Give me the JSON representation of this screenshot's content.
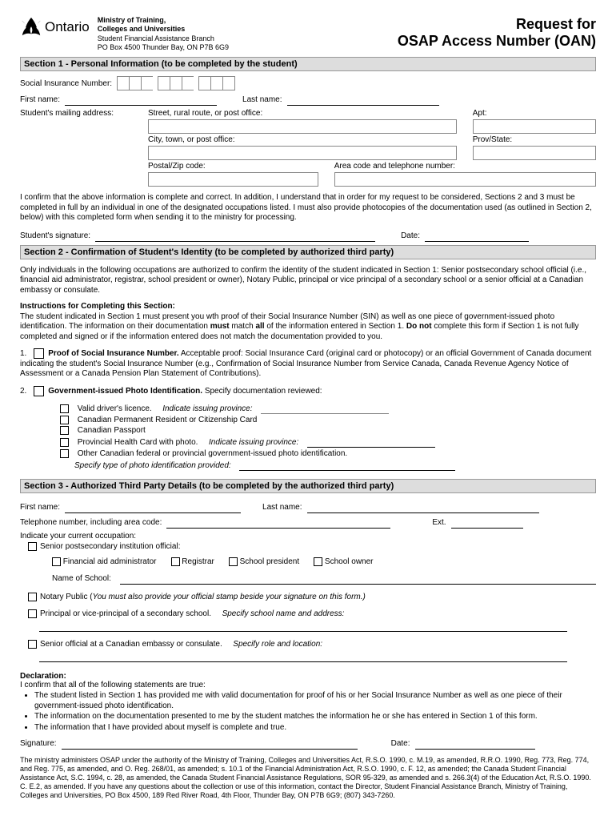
{
  "header": {
    "province": "Ontario",
    "ministry_l1": "Ministry of Training,",
    "ministry_l2": "Colleges and Universities",
    "branch": "Student Financial Assistance Branch",
    "address": "PO Box 4500 Thunder Bay, ON P7B 6G9",
    "title_l1": "Request for",
    "title_l2": "OSAP  Access Number (OAN)"
  },
  "s1": {
    "bar": "Section 1 - Personal Information (to be completed by the student)",
    "sin": "Social Insurance Number:",
    "fname": "First name:",
    "lname": "Last name:",
    "mail": "Student's mailing address:",
    "street": "Street, rural route, or post office:",
    "apt": "Apt:",
    "city": "City, town, or post office:",
    "prov": "Prov/State:",
    "postal": "Postal/Zip code:",
    "phone": "Area code and telephone number:",
    "confirm": "I confirm that the above information is complete and correct.  In addition, I understand that in order for my request to be considered, Sections 2 and 3 must be completed in full by an individual in one of the designated occupations listed.  I must also provide photocopies of the documentation used (as outlined in Section 2, below) with this completed form when sending it to the ministry for processing.",
    "sig": "Student's signature:",
    "date": "Date:"
  },
  "s2": {
    "bar": "Section 2 - Confirmation of Student's Identity (to be completed by authorized third party)",
    "p1": "Only individuals in the following occupations are authorized to confirm the identity of the student indicated in Section 1: Senior postsecondary school official (i.e., financial aid administrator, registrar, school president or owner), Notary Public, principal or vice principal of a secondary school or a senior official at a Canadian embassy or consulate.",
    "instr_h": "Instructions for Completing this Section:",
    "instr": "The student indicated in Section 1 must present you wth proof of their Social Insurance Number (SIN) as well as one piece of government-issued photo identification.  The information on their documentation must match all of the information entered in Section 1.  Do not complete this form if Section 1 is not fully completed and signed or if the information entered does not match the documentation provided to you.",
    "n1": "1.",
    "proof_sin_h": "Proof of Social Insurance Number.",
    "proof_sin": "Acceptable proof:  Social Insurance Card (original card or photocopy) or an official Government of Canada document indicating the student's Social Insurance Number (e.g., Confirmation of Social Insurance Number from Service Canada, Canada Revenue Agency Notice of Assessment or a Canada Pension Plan Statement of Contributions).",
    "n2": "2.",
    "gov_id_h": "Government-issued Photo Identification.",
    "gov_id": "Specify documentation reviewed:",
    "id_dl": "Valid driver's licence.",
    "id_dl_i": "Indicate issuing province:",
    "id_pr": "Canadian Permanent Resident or Citizenship Card",
    "id_pass": "Canadian Passport",
    "id_health": "Provincial Health Card with photo.",
    "id_health_i": "Indicate issuing province:",
    "id_other": "Other Canadian federal or provincial government-issued photo identification.",
    "id_other_i": "Specify type of photo identification provided:"
  },
  "s3": {
    "bar": "Section 3 - Authorized Third Party Details (to be completed by the authorized third party)",
    "fname": "First name:",
    "lname": "Last name:",
    "phone": "Telephone number, including area code:",
    "ext": "Ext.",
    "occ": "Indicate your current occupation:",
    "o_senior": "Senior postsecondary institution official:",
    "o_fin": "Financial aid administrator",
    "o_reg": "Registrar",
    "o_pres": "School president",
    "o_owner": "School owner",
    "school": "Name of School:",
    "o_notary": "Notary Public (",
    "o_notary_i": "You must also provide your official stamp beside your signature on this form.)",
    "o_principal": "Principal or vice-principal of a secondary school.",
    "o_principal_i": "Specify school name and address:",
    "o_embassy": "Senior official at a Canadian embassy or consulate.",
    "o_embassy_i": "Specify role and location:"
  },
  "decl": {
    "h": "Declaration:",
    "intro": "I confirm that all of the following statements are true:",
    "b1": "The student listed in Section 1 has provided me with valid documentation for proof of his or her Social Insurance Number as well as one piece of their government-issued photo identification.",
    "b2": "The information on the documentation presented to me by the student matches the information he or she has entered in Section 1 of this form.",
    "b3": "The information that I have provided about myself is complete and true.",
    "sig": "Signature:",
    "date": "Date:"
  },
  "footer": "The ministry administers OSAP under the authority of the Ministry of Training, Colleges and Universities Act, R.S.O. 1990, c. M.19, as amended, R.R.O. 1990, Reg. 773, Reg. 774, and Reg. 775, as amended, and O. Reg. 268/01, as amended; s. 10.1 of the Financial Administration Act, R.S.O. 1990, c. F. 12, as amended; the Canada Student Financial Assistance Act, S.C. 1994, c. 28, as amended, the Canada Student Financial Assistance Regulations, SOR 95-329, as amended and s. 266.3(4) of the Education Act, R.S.O. 1990. C. E.2, as amended.  If you have any questions about the collection or use of this information, contact the Director, Student Financial Assistance Branch, Ministry of Training, Colleges and Universities, PO Box 4500, 189 Red River Road, 4th Floor, Thunder Bay, ON P7B 6G9; (807) 343-7260."
}
